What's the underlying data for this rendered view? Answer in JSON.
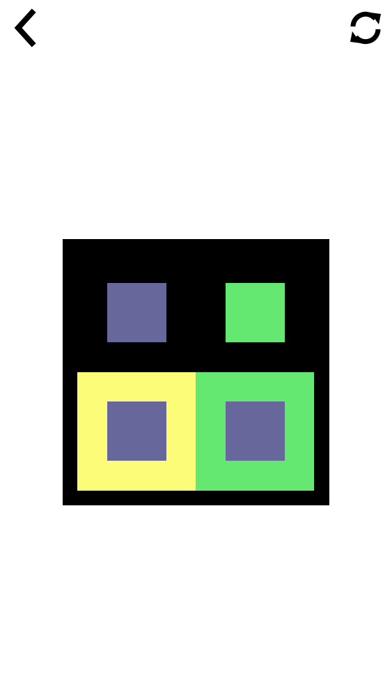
{
  "header": {
    "back_icon": "chevron-left-icon",
    "restart_icon": "refresh-icon"
  },
  "colors": {
    "board": "#000000",
    "purple": "#67679b",
    "green": "#64e872",
    "yellow": "#fdfc78",
    "icon": "#000000"
  },
  "board": {
    "grid": "2x2",
    "cells": [
      {
        "row": 1,
        "col": 1,
        "tile": "none",
        "block": "purple"
      },
      {
        "row": 1,
        "col": 2,
        "tile": "none",
        "block": "green"
      },
      {
        "row": 2,
        "col": 1,
        "tile": "yellow",
        "block": "purple"
      },
      {
        "row": 2,
        "col": 2,
        "tile": "green",
        "block": "purple"
      }
    ]
  }
}
